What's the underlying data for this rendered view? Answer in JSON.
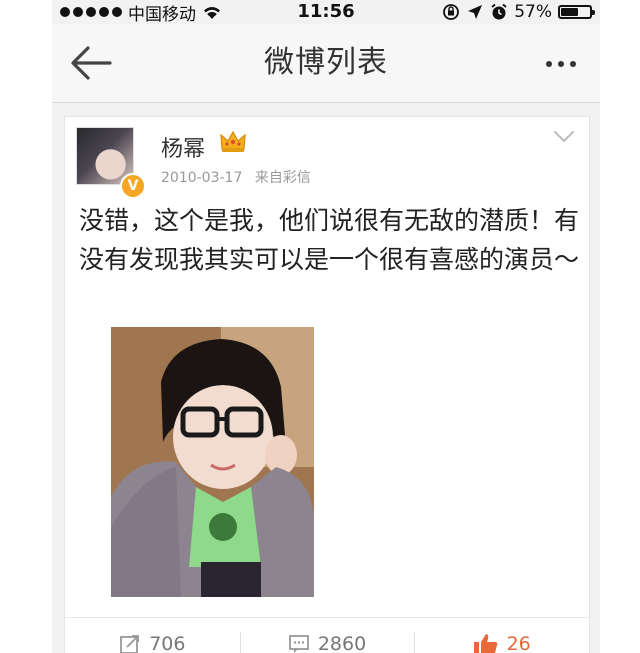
{
  "status_bar": {
    "carrier": "中国移动",
    "time": "11:56",
    "battery_percent": "57%",
    "battery_level": 0.57
  },
  "nav": {
    "title": "微博列表",
    "back_icon": "arrow-left-icon",
    "more_icon": "more-dots-icon"
  },
  "post": {
    "username": "杨幂",
    "date": "2010-03-17",
    "source": "来自彩信",
    "text": "没错，这个是我，他们说很有无敌的潜质！有没有发现我其实可以是一个很有喜感的演员～",
    "verified_badge": "V"
  },
  "actions": {
    "repost_count": "706",
    "comment_count": "2860",
    "like_count": "26"
  },
  "colors": {
    "accent_orange": "#e8683a",
    "badge_orange": "#f5a623",
    "crown_gold": "#e8a100"
  }
}
